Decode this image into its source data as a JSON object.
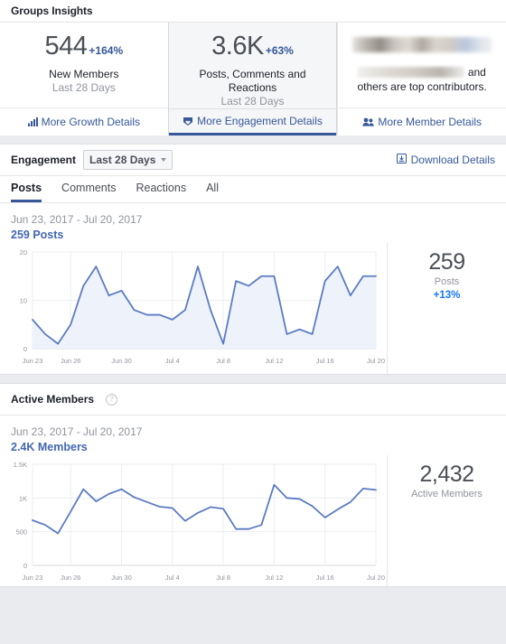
{
  "header": {
    "title": "Groups Insights"
  },
  "cards": [
    {
      "value": "544",
      "delta": "+164%",
      "label": "New Members",
      "sub": "Last 28 Days",
      "link": "More Growth Details",
      "icon": "bar-chart-icon",
      "active": false
    },
    {
      "value": "3.6K",
      "delta": "+63%",
      "label": "Posts, Comments and Reactions",
      "sub": "Last 28 Days",
      "link": "More Engagement Details",
      "icon": "heart-badge-icon",
      "active": true
    },
    {
      "redacted": true,
      "contributors_text": "and others are top contributors.",
      "link": "More Member Details",
      "icon": "people-icon",
      "active": false
    }
  ],
  "engagement": {
    "title": "Engagement",
    "range_selector": "Last 28 Days",
    "download_label": "Download Details",
    "download_icon": "download-icon",
    "tabs": [
      {
        "label": "Posts",
        "selected": true
      },
      {
        "label": "Comments",
        "selected": false
      },
      {
        "label": "Reactions",
        "selected": false
      },
      {
        "label": "All",
        "selected": false
      }
    ],
    "date_range": "Jun 23, 2017 - Jul 20, 2017",
    "count_label": "259 Posts",
    "summary": {
      "value": "259",
      "label": "Posts",
      "delta": "+13%"
    }
  },
  "active_members": {
    "title": "Active Members",
    "help_icon": "question-mark-icon",
    "date_range": "Jun 23, 2017 - Jul 20, 2017",
    "count_label": "2.4K Members",
    "summary": {
      "value": "2,432",
      "label": "Active Members"
    }
  },
  "colors": {
    "accent_blue": "#4267b2",
    "link_blue": "#365899",
    "line_blue": "#5b7bc4",
    "area_fill": "#eef2fa",
    "text_dark": "#1d2129",
    "text_gray": "#90949c",
    "panel_bg": "#ffffff",
    "page_bg": "#e9ebee"
  },
  "chart_data": [
    {
      "type": "area",
      "title": "Posts",
      "xlabel": "",
      "ylabel": "",
      "ylim": [
        0,
        20
      ],
      "yticks": [
        0,
        10,
        20
      ],
      "ytick_labels": [
        "0",
        "10",
        "20"
      ],
      "x": [
        "Jun 23",
        "Jun 24",
        "Jun 25",
        "Jun 26",
        "Jun 27",
        "Jun 28",
        "Jun 29",
        "Jun 30",
        "Jul 1",
        "Jul 2",
        "Jul 3",
        "Jul 4",
        "Jul 5",
        "Jul 6",
        "Jul 7",
        "Jul 8",
        "Jul 9",
        "Jul 10",
        "Jul 11",
        "Jul 12",
        "Jul 13",
        "Jul 14",
        "Jul 15",
        "Jul 16",
        "Jul 17",
        "Jul 18",
        "Jul 19",
        "Jul 20"
      ],
      "xtick_labels": [
        "Jun 23",
        "Jun 26",
        "Jun 30",
        "Jul 4",
        "Jul 8",
        "Jul 12",
        "Jul 16",
        "Jul 20"
      ],
      "xtick_indices": [
        0,
        3,
        7,
        11,
        15,
        19,
        23,
        27
      ],
      "values": [
        6,
        3,
        1,
        5,
        13,
        17,
        11,
        12,
        8,
        7,
        7,
        6,
        8,
        17,
        8,
        1,
        14,
        13,
        15,
        15,
        3,
        4,
        3,
        14,
        17,
        11,
        15,
        15
      ],
      "grid": true,
      "legend": "none"
    },
    {
      "type": "line",
      "title": "Active Members",
      "xlabel": "",
      "ylabel": "",
      "ylim": [
        0,
        1500
      ],
      "yticks": [
        0,
        500,
        1000,
        1500
      ],
      "ytick_labels": [
        "0",
        "500",
        "1K",
        "1.5K"
      ],
      "x": [
        "Jun 23",
        "Jun 24",
        "Jun 25",
        "Jun 26",
        "Jun 27",
        "Jun 28",
        "Jun 29",
        "Jun 30",
        "Jul 1",
        "Jul 2",
        "Jul 3",
        "Jul 4",
        "Jul 5",
        "Jul 6",
        "Jul 7",
        "Jul 8",
        "Jul 9",
        "Jul 10",
        "Jul 11",
        "Jul 12",
        "Jul 13",
        "Jul 14",
        "Jul 15",
        "Jul 16",
        "Jul 17",
        "Jul 18",
        "Jul 19",
        "Jul 20"
      ],
      "xtick_labels": [
        "Jun 23",
        "Jun 26",
        "Jun 30",
        "Jul 4",
        "Jul 8",
        "Jul 12",
        "Jul 16",
        "Jul 20"
      ],
      "xtick_indices": [
        0,
        3,
        7,
        11,
        15,
        19,
        23,
        27
      ],
      "values": [
        670,
        600,
        475,
        800,
        1130,
        950,
        1060,
        1130,
        1010,
        940,
        870,
        850,
        660,
        780,
        865,
        840,
        540,
        540,
        600,
        1195,
        1000,
        985,
        880,
        710,
        830,
        940,
        1140,
        1120
      ],
      "grid": true,
      "legend": "none"
    }
  ]
}
